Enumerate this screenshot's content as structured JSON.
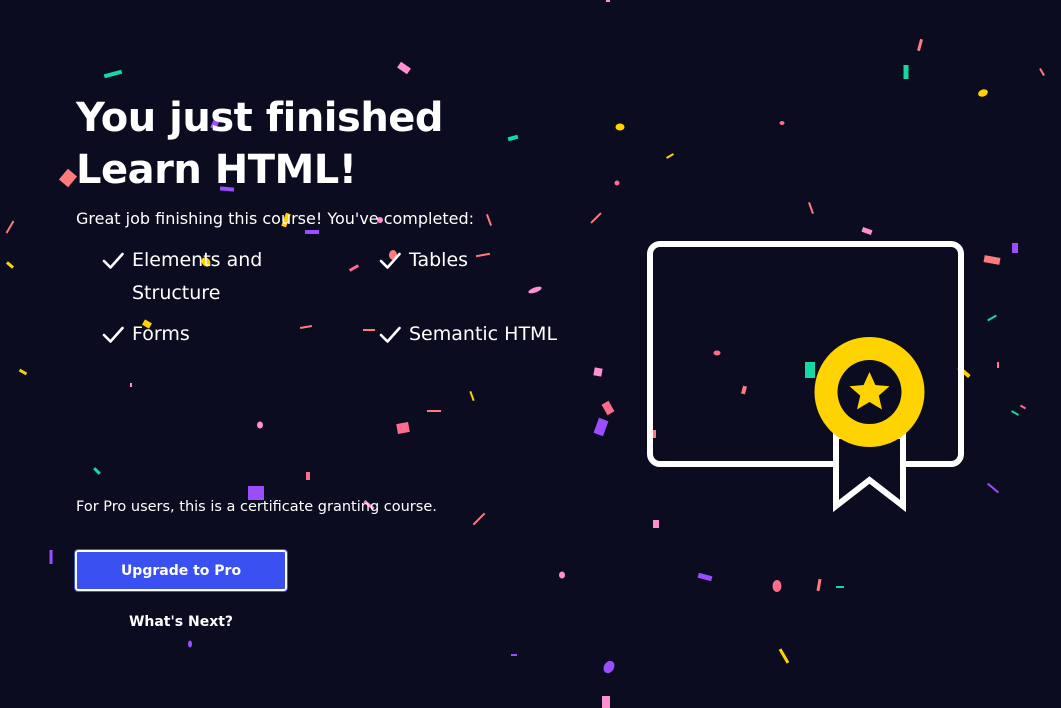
{
  "completion": {
    "headline": "You just finished Learn HTML!",
    "subtext": "Great job finishing this course! You've completed:",
    "completed_items": [
      {
        "label": "Elements and Structure"
      },
      {
        "label": "Tables"
      },
      {
        "label": "Forms"
      },
      {
        "label": "Semantic HTML"
      }
    ],
    "pro_note": "For Pro users, this is a certificate granting course."
  },
  "actions": {
    "upgrade_label": "Upgrade to Pro",
    "whats_next_label": "What's Next?"
  },
  "colors": {
    "background": "#0b0c1f",
    "button": "#3a50f0",
    "badge": "#ffd300",
    "confetti": [
      "#ff6b8a",
      "#9b4dff",
      "#14d9a4",
      "#ffd300",
      "#ff8fd0",
      "#ff7a7a"
    ]
  },
  "icons": {
    "check": "checkmark-icon",
    "certificate": "certificate-icon",
    "star": "star-icon"
  }
}
